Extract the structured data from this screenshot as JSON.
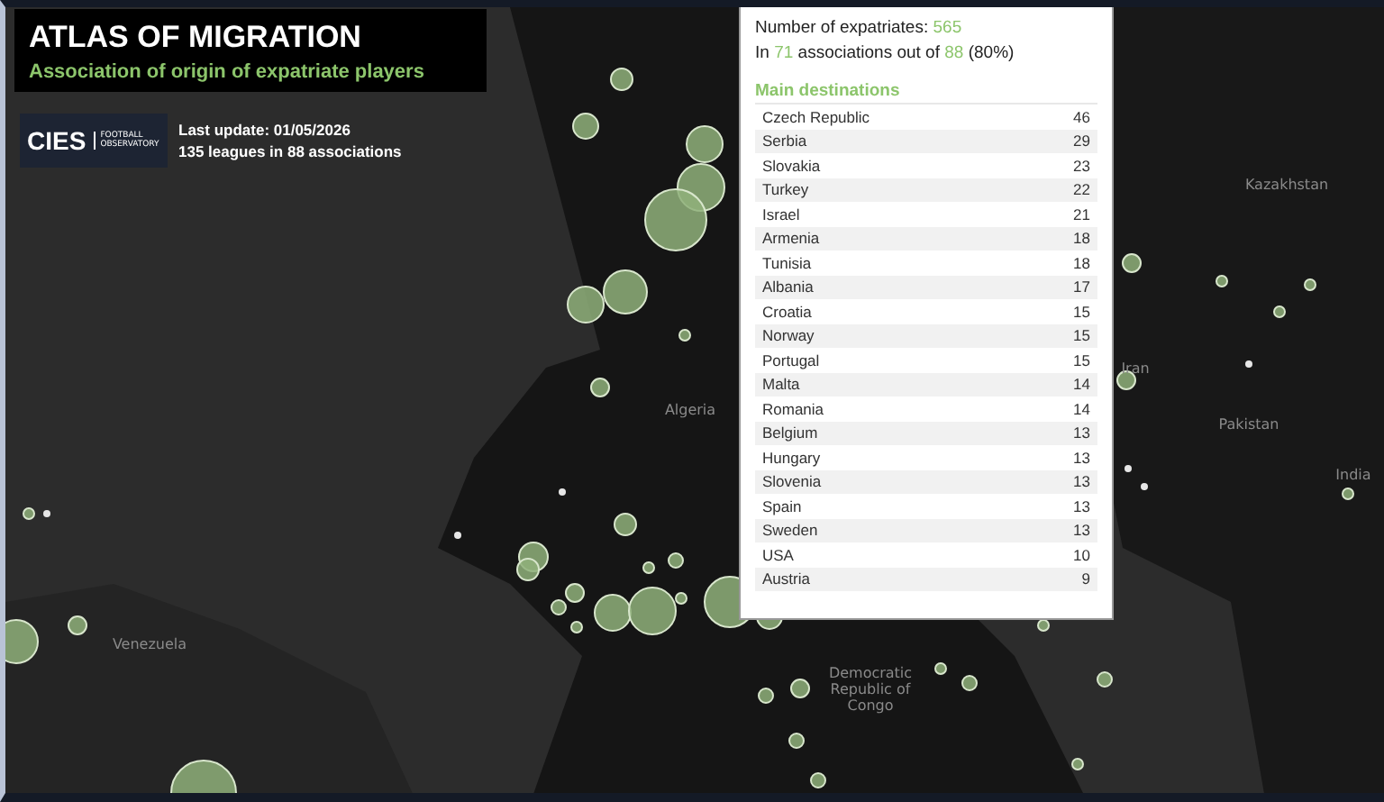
{
  "header": {
    "title": "ATLAS OF MIGRATION",
    "subtitle": "Association of origin of expatriate players"
  },
  "logo": {
    "mark": "CIES",
    "caption_top": "FOOTBALL",
    "caption_bottom": "OBSERVATORY"
  },
  "update": {
    "date_line": "Last update: 01/05/2026",
    "leagues_line": "135 leagues in 88 associations"
  },
  "tooltip": {
    "expatriates": {
      "label": "Number of expatriates:",
      "value": "565"
    },
    "associations": {
      "prefix": "In",
      "count": "71",
      "middle": "associations out of",
      "total": "88",
      "suffix": "(80%)"
    },
    "section_title": "Main destinations",
    "destinations": [
      {
        "country": "Czech Republic",
        "count": "46"
      },
      {
        "country": "Serbia",
        "count": "29"
      },
      {
        "country": "Slovakia",
        "count": "23"
      },
      {
        "country": "Turkey",
        "count": "22"
      },
      {
        "country": "Israel",
        "count": "21"
      },
      {
        "country": "Armenia",
        "count": "18"
      },
      {
        "country": "Tunisia",
        "count": "18"
      },
      {
        "country": "Albania",
        "count": "17"
      },
      {
        "country": "Croatia",
        "count": "15"
      },
      {
        "country": "Norway",
        "count": "15"
      },
      {
        "country": "Portugal",
        "count": "15"
      },
      {
        "country": "Malta",
        "count": "14"
      },
      {
        "country": "Romania",
        "count": "14"
      },
      {
        "country": "Belgium",
        "count": "13"
      },
      {
        "country": "Hungary",
        "count": "13"
      },
      {
        "country": "Slovenia",
        "count": "13"
      },
      {
        "country": "Spain",
        "count": "13"
      },
      {
        "country": "Sweden",
        "count": "13"
      },
      {
        "country": "USA",
        "count": "10"
      },
      {
        "country": "Austria",
        "count": "9"
      }
    ]
  },
  "map_labels": [
    "Kazakhstan",
    "Algeria",
    "Iran",
    "Pakistan",
    "India",
    "Venezuela",
    "Democratic Republic of Congo"
  ]
}
